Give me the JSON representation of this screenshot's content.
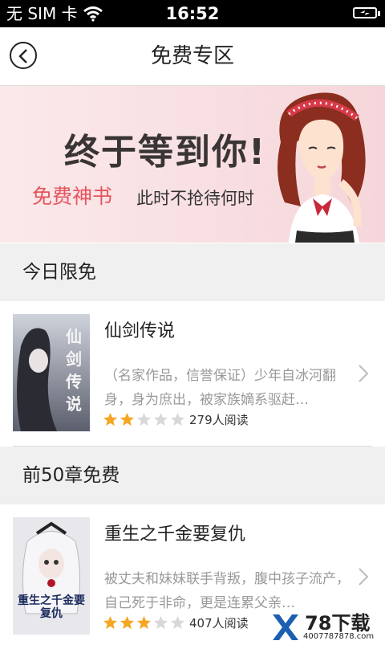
{
  "status_bar": {
    "carrier": "无 SIM 卡",
    "time": "16:52"
  },
  "nav": {
    "title": "免费专区"
  },
  "banner": {
    "headline": "终于等到你!",
    "tag": "免费神书",
    "slogan": "此时不抢待何时"
  },
  "sections": [
    {
      "label": "今日限免",
      "book": {
        "cover_text": "仙剑传说",
        "title": "仙剑传说",
        "description": "（名家作品，信誉保证）少年自冰河翻身，身为庶出，被家族嫡系驱赶…",
        "rating": 2,
        "rating_max": 5,
        "reads": "279人阅读"
      }
    },
    {
      "label": "前50章免费",
      "book": {
        "cover_text": "重生之千金要复仇",
        "title": "重生之千金要复仇",
        "description": "被丈夫和妹妹联手背叛，腹中孩子流产，自己死于非命，更是连累父亲…",
        "rating": 3,
        "rating_max": 5,
        "reads": "407人阅读"
      }
    }
  ],
  "watermark": {
    "brand": "78下载",
    "url": "4007787878.com"
  },
  "colors": {
    "accent_red": "#e6545c",
    "star_filled": "#f5a623",
    "star_empty": "#d8d8d8"
  }
}
